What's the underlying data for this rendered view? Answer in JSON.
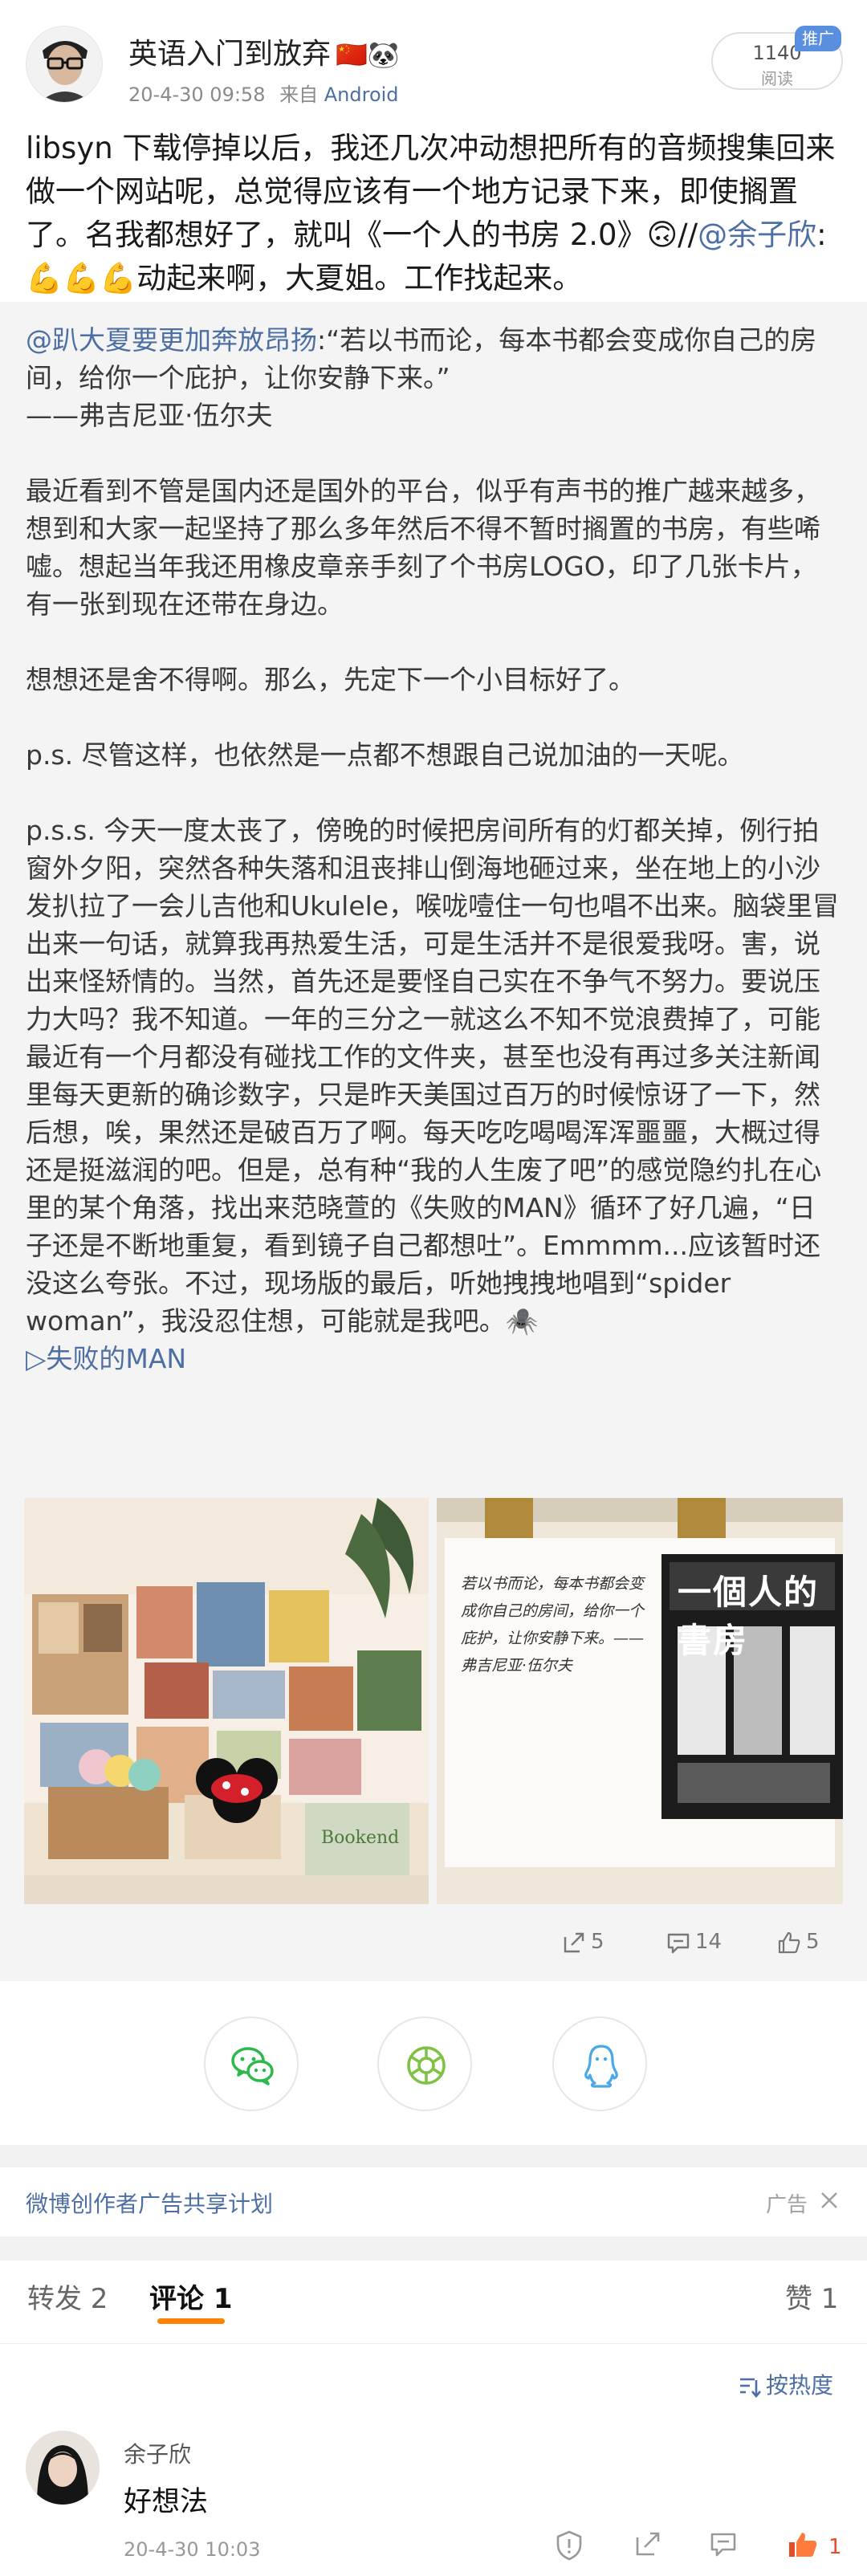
{
  "header": {
    "username": "英语入门到放弃",
    "username_emoji": "🇨🇳🐼",
    "time": "20-4-30 09:58",
    "source_prefix": "来自",
    "source": "Android",
    "read_count": "1140",
    "read_label": "阅读",
    "promo_tag": "推广"
  },
  "repost": {
    "text_main": "libsyn 下载停掉以后，我还几次冲动想把所有的音频搜集回来做一个网站呢，总觉得应该有一个地方记录下来，即使搁置了。名我都想好了，就叫《一个人的书房 2.0》🙃//",
    "mention": "@余子欣",
    "text_after_mention": ":",
    "text_tail": "💪💪💪动起来啊，大夏姐。工作找起来。"
  },
  "original": {
    "author": "@趴大夏要更加奔放昂扬",
    "quote": ":“若以书而论，每本书都会变成你自己的房间，给你一个庇护，让你安静下来。”",
    "quote_author": "——弗吉尼亚·伍尔夫",
    "paragraph1": "最近看到不管是国内还是国外的平台，似乎有声书的推广越来越多，想到和大家一起坚持了那么多年然后不得不暂时搁置的书房，有些唏嘘。想起当年我还用橡皮章亲手刻了个书房LOGO，印了几张卡片，有一张到现在还带在身边。",
    "paragraph2": "想想还是舍不得啊。那么，先定下一个小目标好了。",
    "paragraph3": "p.s. 尽管这样，也依然是一点都不想跟自己说加油的一天呢。",
    "paragraph4": "p.s.s. 今天一度太丧了，傍晚的时候把房间所有的灯都关掉，例行拍窗外夕阳，突然各种失落和沮丧排山倒海地砸过来，坐在地上的小沙发扒拉了一会儿吉他和Ukulele，喉咙噎住一句也唱不出来。脑袋里冒出来一句话，就算我再热爱生活，可是生活并不是很爱我呀。害，说出来怪矫情的。当然，首先还是要怪自己实在不争气不努力。要说压力大吗？我不知道。一年的三分之一就这么不知不觉浪费掉了，可能最近有一个月都没有碰找工作的文件夹，甚至也没有再过多关注新闻里每天更新的确诊数字，只是昨天美国过百万的时候惊讶了一下，然后想，唉，果然还是破百万了啊。每天吃吃喝喝浑浑噩噩，大概过得还是挺滋润的吧。但是，总有种“我的人生废了吧”的感觉隐约扎在心里的某个角落，找出来范晓萱的《失败的MAN》循环了好几遍，“日子还是不断地重复，看到镜子自己都想吐”。Emmmm...应该暂时还没这么夸张。不过，现场版的最后，听她拽拽地唱到“spider woman”，我没忍住想，可能就是我吧。🕷️",
    "music_link": "▷失败的MAN",
    "image_right_text": "若以书而论，每本书都会变成你自己的房间，给你一个庇护，让你安静下来。—— 弗吉尼亚·伍尔夫",
    "image_right_title": "一個人的書房",
    "repost_count": "5",
    "comment_count": "14",
    "like_count": "5"
  },
  "share": {
    "wechat": "wechat-share",
    "moments": "moments-share",
    "qq": "qq-share"
  },
  "ad": {
    "link": "微博创作者广告共享计划",
    "tag": "广告"
  },
  "tabs": {
    "repost": "转发 2",
    "comment": "评论 1",
    "like": "赞 1"
  },
  "sort": "按热度",
  "comment": {
    "user": "余子欣",
    "text": "好想法",
    "time": "20-4-30 10:03",
    "likes": "1"
  },
  "colors": {
    "link": "#4e6fa3",
    "accent": "#ff8200",
    "like_active": "#e44f2a",
    "promo": "#5a8fe0",
    "share_green": "#2db84c"
  }
}
